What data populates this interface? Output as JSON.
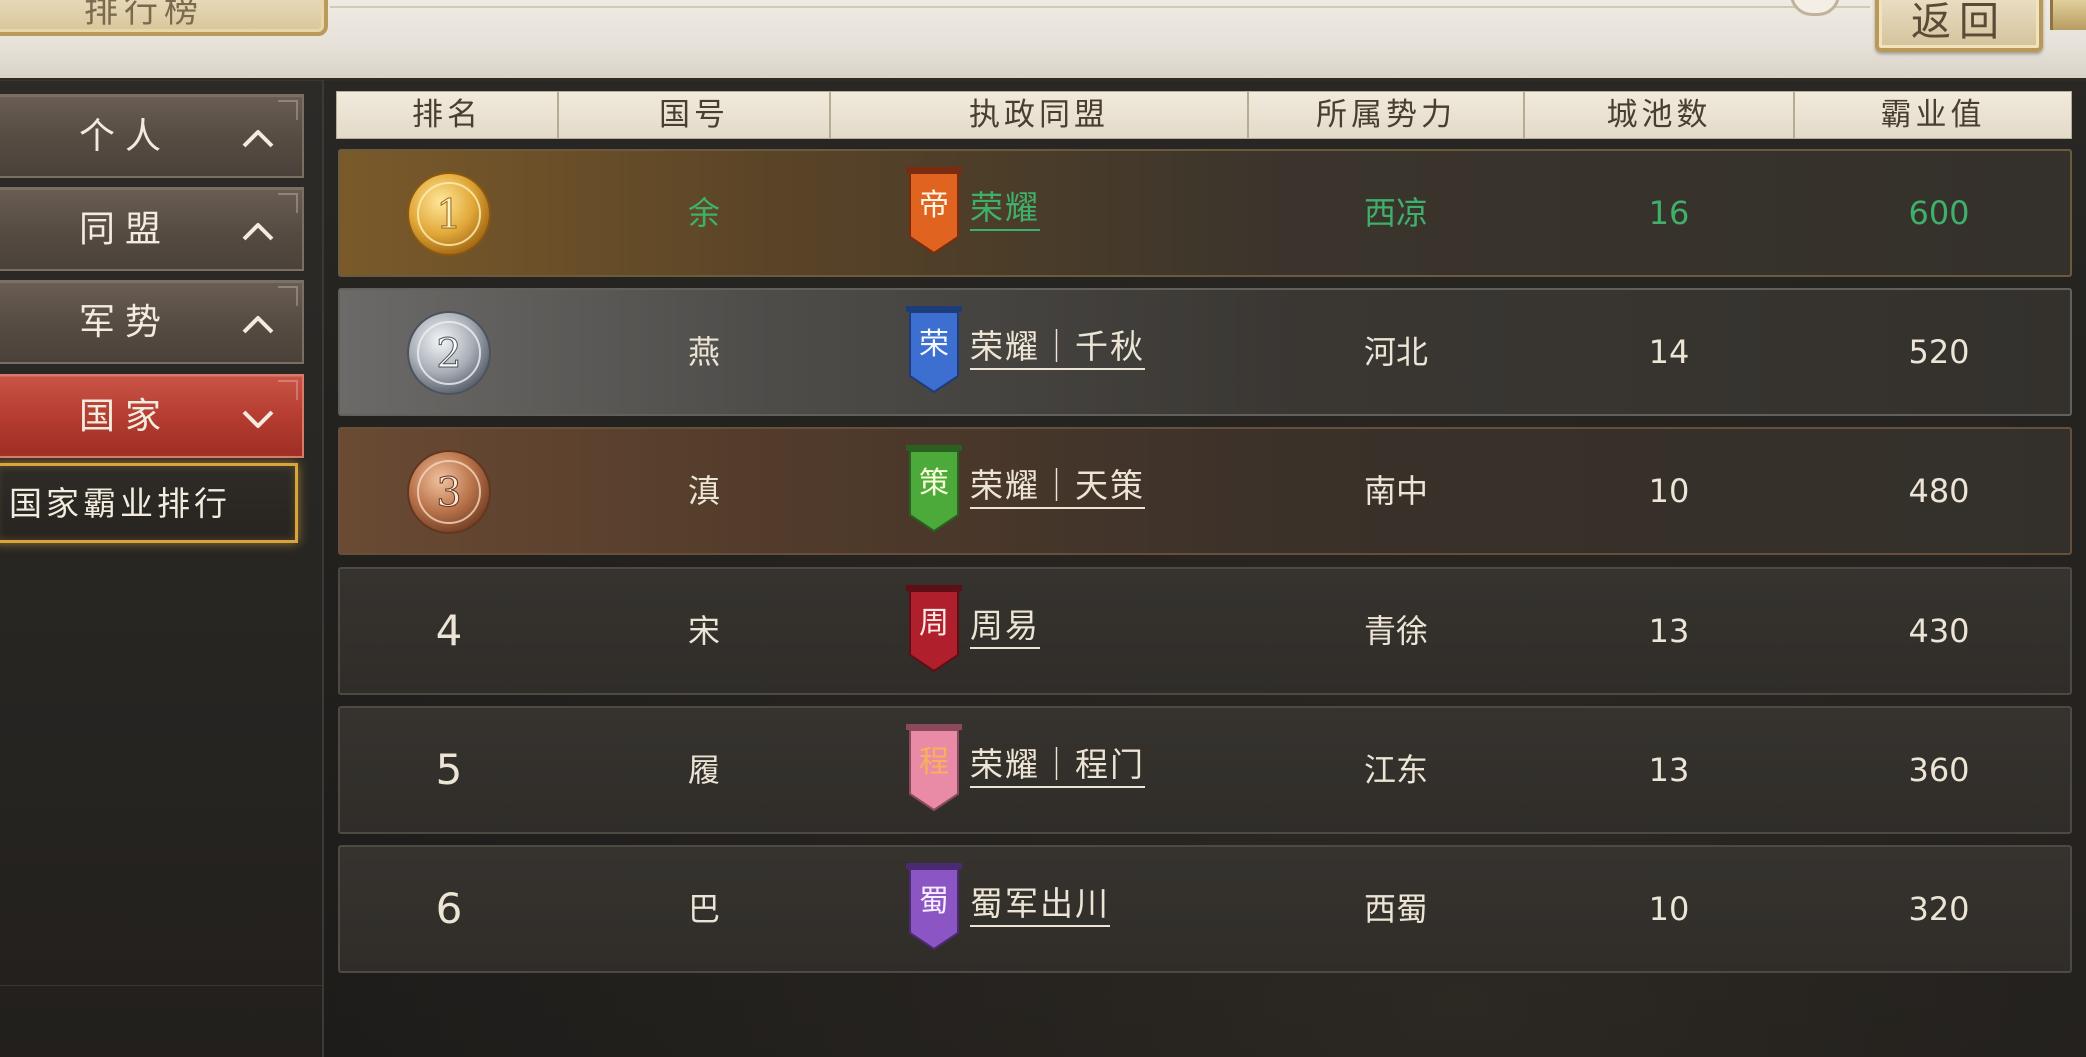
{
  "header": {
    "title": "排行榜",
    "back_label": "返回"
  },
  "sidebar": {
    "items": [
      {
        "label": "个人",
        "expanded": false
      },
      {
        "label": "同盟",
        "expanded": false
      },
      {
        "label": "军势",
        "expanded": false
      },
      {
        "label": "国家",
        "expanded": true
      }
    ],
    "sub_items": [
      {
        "label": "国家霸业排行",
        "selected": true
      }
    ]
  },
  "table": {
    "columns": [
      "排名",
      "国号",
      "执政同盟",
      "所属势力",
      "城池数",
      "霸业值"
    ],
    "rows": [
      {
        "rank": "1",
        "medal": "gold",
        "state": "余",
        "flag_char": "帝",
        "flag_color": "#e0631f",
        "alliance": "荣耀",
        "faction": "西凉",
        "cities": "16",
        "score": "600",
        "highlight": true
      },
      {
        "rank": "2",
        "medal": "silver",
        "state": "燕",
        "flag_char": "荣",
        "flag_color": "#3c6fcf",
        "alliance": "荣耀｜千秋",
        "faction": "河北",
        "cities": "14",
        "score": "520",
        "highlight": false
      },
      {
        "rank": "3",
        "medal": "bronze",
        "state": "滇",
        "flag_char": "策",
        "flag_color": "#4caa3a",
        "alliance": "荣耀｜天策",
        "faction": "南中",
        "cities": "10",
        "score": "480",
        "highlight": false
      },
      {
        "rank": "4",
        "medal": "",
        "state": "宋",
        "flag_char": "周",
        "flag_color": "#b0202c",
        "alliance": "周易",
        "faction": "青徐",
        "cities": "13",
        "score": "430",
        "highlight": false
      },
      {
        "rank": "5",
        "medal": "",
        "state": "履",
        "flag_char": "程",
        "flag_color": "#e98aa6",
        "alliance": "荣耀｜程门",
        "faction": "江东",
        "cities": "13",
        "score": "360",
        "highlight": false
      },
      {
        "rank": "6",
        "medal": "",
        "state": "巴",
        "flag_char": "蜀",
        "flag_color": "#8b55c4",
        "alliance": "蜀军出川",
        "faction": "西蜀",
        "cities": "10",
        "score": "320",
        "highlight": false
      }
    ]
  },
  "colors": {
    "highlight_text": "#3fb06a",
    "nav_active": "#b33b2f",
    "sub_item_border": "#d9a43a"
  }
}
